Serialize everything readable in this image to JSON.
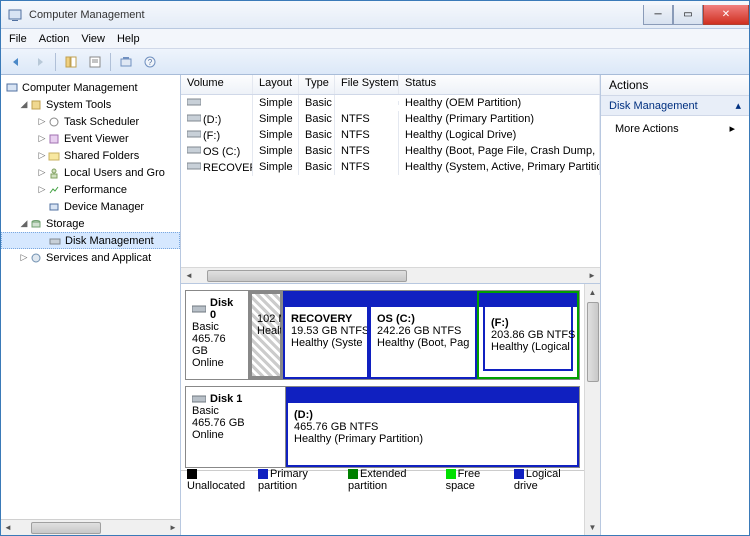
{
  "window": {
    "title": "Computer Management"
  },
  "menu": {
    "file": "File",
    "action": "Action",
    "view": "View",
    "help": "Help"
  },
  "tree": {
    "root": "Computer Management",
    "system_tools": "System Tools",
    "task_scheduler": "Task Scheduler",
    "event_viewer": "Event Viewer",
    "shared_folders": "Shared Folders",
    "local_users": "Local Users and Gro",
    "performance": "Performance",
    "device_manager": "Device Manager",
    "storage": "Storage",
    "disk_management": "Disk Management",
    "services": "Services and Applicat"
  },
  "vol_headers": {
    "volume": "Volume",
    "layout": "Layout",
    "type": "Type",
    "fs": "File System",
    "status": "Status"
  },
  "volumes": [
    {
      "name": "",
      "layout": "Simple",
      "type": "Basic",
      "fs": "",
      "status": "Healthy (OEM Partition)"
    },
    {
      "name": "(D:)",
      "layout": "Simple",
      "type": "Basic",
      "fs": "NTFS",
      "status": "Healthy (Primary Partition)"
    },
    {
      "name": "(F:)",
      "layout": "Simple",
      "type": "Basic",
      "fs": "NTFS",
      "status": "Healthy (Logical Drive)"
    },
    {
      "name": "OS (C:)",
      "layout": "Simple",
      "type": "Basic",
      "fs": "NTFS",
      "status": "Healthy (Boot, Page File, Crash Dump, Primary"
    },
    {
      "name": "RECOVERY",
      "layout": "Simple",
      "type": "Basic",
      "fs": "NTFS",
      "status": "Healthy (System, Active, Primary Partition)"
    }
  ],
  "disks": {
    "d0": {
      "name": "Disk 0",
      "type": "Basic",
      "size": "465.76 GB",
      "state": "Online"
    },
    "d0p0": {
      "line1": "102 M",
      "line2": "Healt"
    },
    "d0p1": {
      "name": "RECOVERY",
      "line1": "19.53 GB NTFS",
      "line2": "Healthy (Syste"
    },
    "d0p2": {
      "name": "OS  (C:)",
      "line1": "242.26 GB NTFS",
      "line2": "Healthy (Boot, Pag"
    },
    "d0p3": {
      "name": "(F:)",
      "line1": "203.86 GB NTFS",
      "line2": "Healthy (Logical"
    },
    "d1": {
      "name": "Disk 1",
      "type": "Basic",
      "size": "465.76 GB",
      "state": "Online"
    },
    "d1p0": {
      "name": "(D:)",
      "line1": "465.76 GB NTFS",
      "line2": "Healthy (Primary Partition)"
    }
  },
  "legend": {
    "unalloc": "Unallocated",
    "primary": "Primary partition",
    "extended": "Extended partition",
    "free": "Free space",
    "logical": "Logical drive"
  },
  "actions": {
    "header": "Actions",
    "group": "Disk Management",
    "more": "More Actions"
  }
}
